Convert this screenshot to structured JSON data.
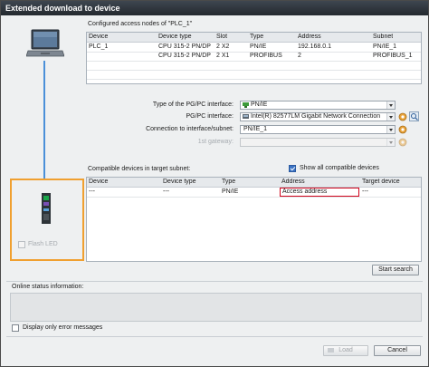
{
  "window": {
    "title": "Extended download to device"
  },
  "config_nodes": {
    "heading": "Configured access nodes of \"PLC_1\"",
    "columns": [
      "Device",
      "Device type",
      "Slot",
      "Type",
      "Address",
      "Subnet"
    ],
    "rows": [
      [
        "PLC_1",
        "CPU 315-2 PN/DP",
        "2 X2",
        "PN/IE",
        "192.168.0.1",
        "PN/IE_1"
      ],
      [
        "",
        "CPU 315-2 PN/DP",
        "2 X1",
        "PROFIBUS",
        "2",
        "PROFIBUS_1"
      ]
    ]
  },
  "settings": {
    "pgpc_type_label": "Type of the PG/PC interface:",
    "pgpc_type_value": "PN/IE",
    "pgpc_iface_label": "PG/PC interface:",
    "pgpc_iface_value": "Intel(R) 82577LM Gigabit Network Connection",
    "conn_label": "Connection to interface/subnet:",
    "conn_value": "PN/IE_1",
    "gateway_label": "1st gateway:",
    "gateway_value": ""
  },
  "compatible": {
    "heading": "Compatible devices in target subnet:",
    "show_all_label": "Show all compatible devices",
    "show_all_checked": true,
    "columns": [
      "Device",
      "Device type",
      "Type",
      "Address",
      "Target device"
    ],
    "rows": [
      [
        "---",
        "---",
        "PN/IE",
        "Access address",
        "---"
      ]
    ],
    "highlight_color": "#d0021b"
  },
  "device_panel": {
    "flash_led_label": "Flash LED",
    "highlight_color": "#f0a030"
  },
  "buttons": {
    "start_search": "Start search",
    "load": "Load",
    "cancel": "Cancel"
  },
  "status": {
    "label": "Online status information:",
    "error_only_label": "Display only error messages"
  },
  "colors": {
    "title_bar": "#2c323a",
    "accent": "#3a73c4"
  },
  "icons": [
    "laptop-icon",
    "plc-device-icon",
    "network-port-icon",
    "properties-icon",
    "diagnostics-icon"
  ]
}
